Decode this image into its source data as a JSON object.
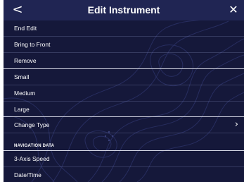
{
  "header": {
    "title": "Edit Instrument",
    "back_icon": "chevron-left-icon",
    "back_glyph": "<",
    "close_icon": "close-icon",
    "close_glyph": "✕"
  },
  "menu": {
    "group1": [
      "End Edit",
      "Bring to Front",
      "Remove"
    ],
    "group2": [
      "Small",
      "Medium",
      "Large"
    ],
    "change_type": "Change Type",
    "change_type_chevron": "›"
  },
  "navigation": {
    "section_title": "NAVIGATION DATA",
    "items": [
      "3-Axis Speed",
      "Date/Time"
    ]
  },
  "colors": {
    "background": "#15183a",
    "title_bar": "#202553",
    "text": "#ffffff"
  }
}
